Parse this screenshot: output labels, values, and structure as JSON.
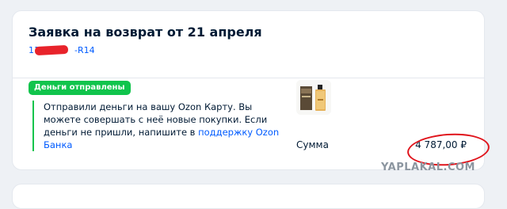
{
  "request": {
    "title": "Заявка на возврат от 21 апреля",
    "order_prefix": "11",
    "order_suffix": "-R14"
  },
  "status": {
    "badge": "Деньги отправлены",
    "badge_color": "#10c44c"
  },
  "message": {
    "text_before_link": "Отправили деньги на вашу Ozon Карту. Вы можете совершать с неё новые покупки. Если деньги не пришли, напишите в ",
    "link_text": "поддержку Ozon Банка"
  },
  "product": {
    "thumbnail_icon": "perfume-bottle-icon"
  },
  "summary": {
    "label": "Сумма",
    "amount": "4 787,00 ₽"
  },
  "watermark": "YAPLAKAL.COM",
  "colors": {
    "link": "#005bff",
    "annotation_red": "#e0141c"
  }
}
